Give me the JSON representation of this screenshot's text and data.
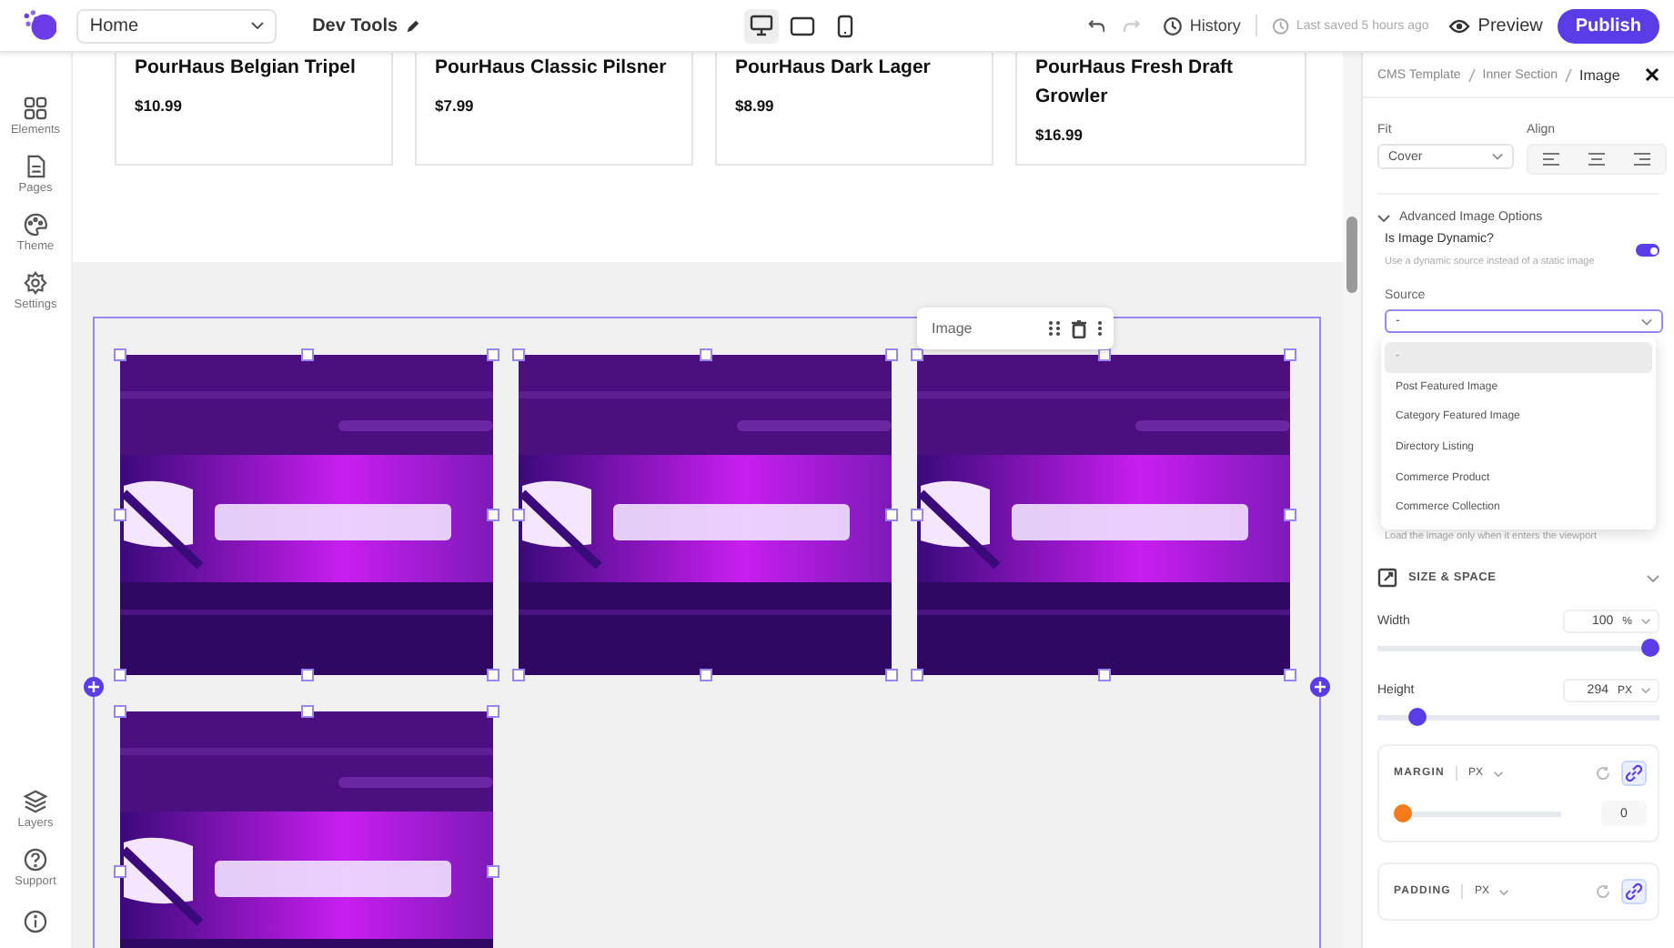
{
  "top_bar": {
    "page_select": "Home",
    "title": "Dev Tools",
    "devices": [
      {
        "kind": "desktop",
        "selected": true
      },
      {
        "kind": "tablet",
        "selected": false
      },
      {
        "kind": "mobile",
        "selected": false
      }
    ],
    "history": "History",
    "last_saved": "Last saved 5 hours ago",
    "preview": "Preview",
    "publish": "Publish"
  },
  "sidebar": {
    "items": [
      "Elements",
      "Pages",
      "Theme",
      "Settings"
    ],
    "bottom_items": [
      "Layers",
      "Support"
    ]
  },
  "products": [
    {
      "name": "PourHaus Belgian Tripel",
      "price": "$10.99"
    },
    {
      "name": "PourHaus Classic Pilsner",
      "price": "$7.99"
    },
    {
      "name": "PourHaus Dark Lager",
      "price": "$8.99"
    },
    {
      "name": "PourHaus Fresh Draft Growler",
      "price": "$16.99"
    }
  ],
  "element_toolbar": {
    "label": "Image"
  },
  "panel": {
    "breadcrumb": [
      "CMS Template",
      "Inner Section",
      "Image"
    ],
    "fit": {
      "label": "Fit",
      "value": "Cover"
    },
    "align": {
      "label": "Align",
      "options": [
        {
          "kind": "left"
        },
        {
          "kind": "center"
        },
        {
          "kind": "right"
        }
      ]
    },
    "advanced": {
      "label": "Advanced Image Options",
      "expanded": true
    },
    "dynamic": {
      "label": "Is Image Dynamic?",
      "hint": "Use a dynamic source instead of a static image",
      "on": true
    },
    "source": {
      "label": "Source",
      "value": "-",
      "options": [
        {
          "label": "-",
          "selected": true
        },
        {
          "label": "Post Featured Image",
          "selected": false
        },
        {
          "label": "Category Featured Image",
          "selected": false
        },
        {
          "label": "Directory Listing",
          "selected": false
        },
        {
          "label": "Commerce Product",
          "selected": false
        },
        {
          "label": "Commerce Collection",
          "selected": false
        }
      ]
    },
    "lazy_hint": "Load the image only when it enters the viewport",
    "size_space": {
      "title": "SIZE & SPACE",
      "width": {
        "label": "Width",
        "value": "100",
        "unit": "%",
        "level": 1
      },
      "height": {
        "label": "Height",
        "value": "294",
        "unit": "PX",
        "level": 0.12
      }
    },
    "margin": {
      "label": "MARGIN",
      "unit": "PX",
      "level": 0,
      "value": "0",
      "linked": true
    },
    "padding": {
      "label": "PADDING",
      "unit": "PX",
      "linked": true
    }
  }
}
